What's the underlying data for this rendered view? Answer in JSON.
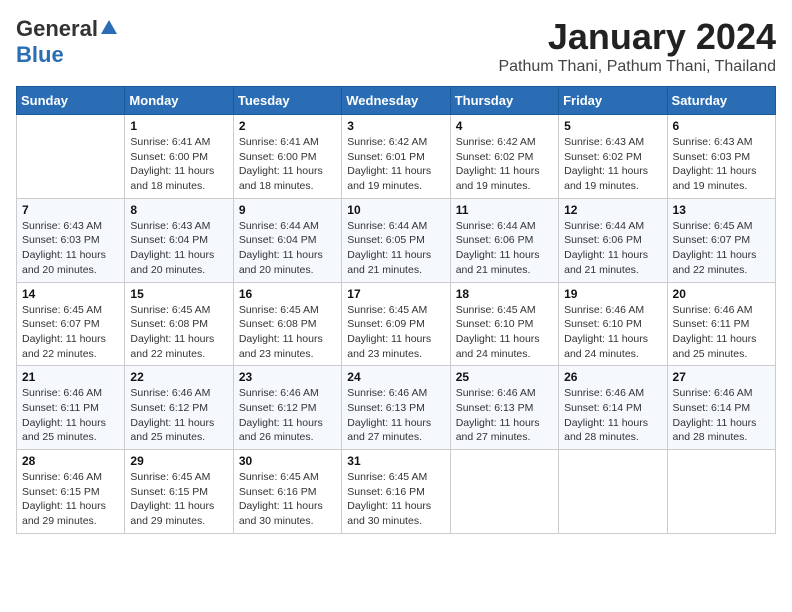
{
  "header": {
    "logo_general": "General",
    "logo_blue": "Blue",
    "title": "January 2024",
    "location": "Pathum Thani, Pathum Thani, Thailand"
  },
  "days_of_week": [
    "Sunday",
    "Monday",
    "Tuesday",
    "Wednesday",
    "Thursday",
    "Friday",
    "Saturday"
  ],
  "weeks": [
    [
      {
        "day": "",
        "info": ""
      },
      {
        "day": "1",
        "info": "Sunrise: 6:41 AM\nSunset: 6:00 PM\nDaylight: 11 hours\nand 18 minutes."
      },
      {
        "day": "2",
        "info": "Sunrise: 6:41 AM\nSunset: 6:00 PM\nDaylight: 11 hours\nand 18 minutes."
      },
      {
        "day": "3",
        "info": "Sunrise: 6:42 AM\nSunset: 6:01 PM\nDaylight: 11 hours\nand 19 minutes."
      },
      {
        "day": "4",
        "info": "Sunrise: 6:42 AM\nSunset: 6:02 PM\nDaylight: 11 hours\nand 19 minutes."
      },
      {
        "day": "5",
        "info": "Sunrise: 6:43 AM\nSunset: 6:02 PM\nDaylight: 11 hours\nand 19 minutes."
      },
      {
        "day": "6",
        "info": "Sunrise: 6:43 AM\nSunset: 6:03 PM\nDaylight: 11 hours\nand 19 minutes."
      }
    ],
    [
      {
        "day": "7",
        "info": "Sunrise: 6:43 AM\nSunset: 6:03 PM\nDaylight: 11 hours\nand 20 minutes."
      },
      {
        "day": "8",
        "info": "Sunrise: 6:43 AM\nSunset: 6:04 PM\nDaylight: 11 hours\nand 20 minutes."
      },
      {
        "day": "9",
        "info": "Sunrise: 6:44 AM\nSunset: 6:04 PM\nDaylight: 11 hours\nand 20 minutes."
      },
      {
        "day": "10",
        "info": "Sunrise: 6:44 AM\nSunset: 6:05 PM\nDaylight: 11 hours\nand 21 minutes."
      },
      {
        "day": "11",
        "info": "Sunrise: 6:44 AM\nSunset: 6:06 PM\nDaylight: 11 hours\nand 21 minutes."
      },
      {
        "day": "12",
        "info": "Sunrise: 6:44 AM\nSunset: 6:06 PM\nDaylight: 11 hours\nand 21 minutes."
      },
      {
        "day": "13",
        "info": "Sunrise: 6:45 AM\nSunset: 6:07 PM\nDaylight: 11 hours\nand 22 minutes."
      }
    ],
    [
      {
        "day": "14",
        "info": "Sunrise: 6:45 AM\nSunset: 6:07 PM\nDaylight: 11 hours\nand 22 minutes."
      },
      {
        "day": "15",
        "info": "Sunrise: 6:45 AM\nSunset: 6:08 PM\nDaylight: 11 hours\nand 22 minutes."
      },
      {
        "day": "16",
        "info": "Sunrise: 6:45 AM\nSunset: 6:08 PM\nDaylight: 11 hours\nand 23 minutes."
      },
      {
        "day": "17",
        "info": "Sunrise: 6:45 AM\nSunset: 6:09 PM\nDaylight: 11 hours\nand 23 minutes."
      },
      {
        "day": "18",
        "info": "Sunrise: 6:45 AM\nSunset: 6:10 PM\nDaylight: 11 hours\nand 24 minutes."
      },
      {
        "day": "19",
        "info": "Sunrise: 6:46 AM\nSunset: 6:10 PM\nDaylight: 11 hours\nand 24 minutes."
      },
      {
        "day": "20",
        "info": "Sunrise: 6:46 AM\nSunset: 6:11 PM\nDaylight: 11 hours\nand 25 minutes."
      }
    ],
    [
      {
        "day": "21",
        "info": "Sunrise: 6:46 AM\nSunset: 6:11 PM\nDaylight: 11 hours\nand 25 minutes."
      },
      {
        "day": "22",
        "info": "Sunrise: 6:46 AM\nSunset: 6:12 PM\nDaylight: 11 hours\nand 25 minutes."
      },
      {
        "day": "23",
        "info": "Sunrise: 6:46 AM\nSunset: 6:12 PM\nDaylight: 11 hours\nand 26 minutes."
      },
      {
        "day": "24",
        "info": "Sunrise: 6:46 AM\nSunset: 6:13 PM\nDaylight: 11 hours\nand 27 minutes."
      },
      {
        "day": "25",
        "info": "Sunrise: 6:46 AM\nSunset: 6:13 PM\nDaylight: 11 hours\nand 27 minutes."
      },
      {
        "day": "26",
        "info": "Sunrise: 6:46 AM\nSunset: 6:14 PM\nDaylight: 11 hours\nand 28 minutes."
      },
      {
        "day": "27",
        "info": "Sunrise: 6:46 AM\nSunset: 6:14 PM\nDaylight: 11 hours\nand 28 minutes."
      }
    ],
    [
      {
        "day": "28",
        "info": "Sunrise: 6:46 AM\nSunset: 6:15 PM\nDaylight: 11 hours\nand 29 minutes."
      },
      {
        "day": "29",
        "info": "Sunrise: 6:45 AM\nSunset: 6:15 PM\nDaylight: 11 hours\nand 29 minutes."
      },
      {
        "day": "30",
        "info": "Sunrise: 6:45 AM\nSunset: 6:16 PM\nDaylight: 11 hours\nand 30 minutes."
      },
      {
        "day": "31",
        "info": "Sunrise: 6:45 AM\nSunset: 6:16 PM\nDaylight: 11 hours\nand 30 minutes."
      },
      {
        "day": "",
        "info": ""
      },
      {
        "day": "",
        "info": ""
      },
      {
        "day": "",
        "info": ""
      }
    ]
  ]
}
